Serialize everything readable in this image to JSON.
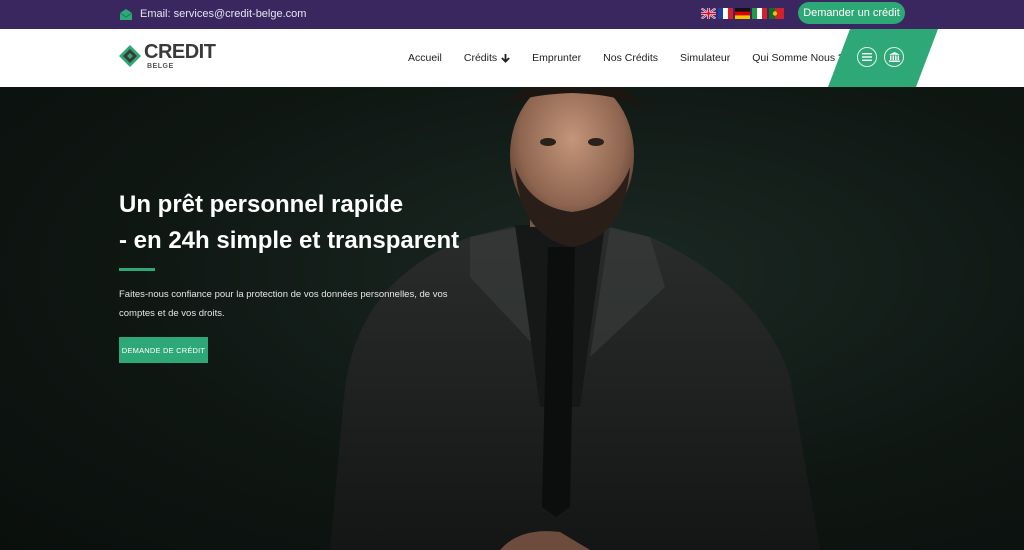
{
  "topbar": {
    "email_label": "Email: services@credit-belge.com",
    "cta_label": "Demander un crédit",
    "flags": [
      "english-flag-icon",
      "french-flag-icon",
      "german-flag-icon",
      "italian-flag-icon",
      "portuguese-flag-icon"
    ]
  },
  "brand": {
    "name": "CREDIT",
    "sub": "BELGE"
  },
  "nav": {
    "items": [
      {
        "label": "Accueil"
      },
      {
        "label": "Crédits"
      },
      {
        "label": "Emprunter"
      },
      {
        "label": "Nos Crédits"
      },
      {
        "label": "Simulateur"
      },
      {
        "label": "Qui Somme Nous ?"
      }
    ],
    "icons": [
      "menu-icon",
      "bank-icon"
    ]
  },
  "hero": {
    "title_line1": "Un prêt personnel rapide",
    "title_line2": "- en 24h simple et transparent",
    "text": "Faites-nous confiance pour la protection de vos données personnelles, de vos comptes et de vos droits.",
    "button_label": "DEMANDE DE CRÉDIT"
  },
  "colors": {
    "topbar": "#3a2760",
    "accent": "#2ea876",
    "hero_bg": "#0f1512",
    "nav_bg": "#ffffff"
  }
}
